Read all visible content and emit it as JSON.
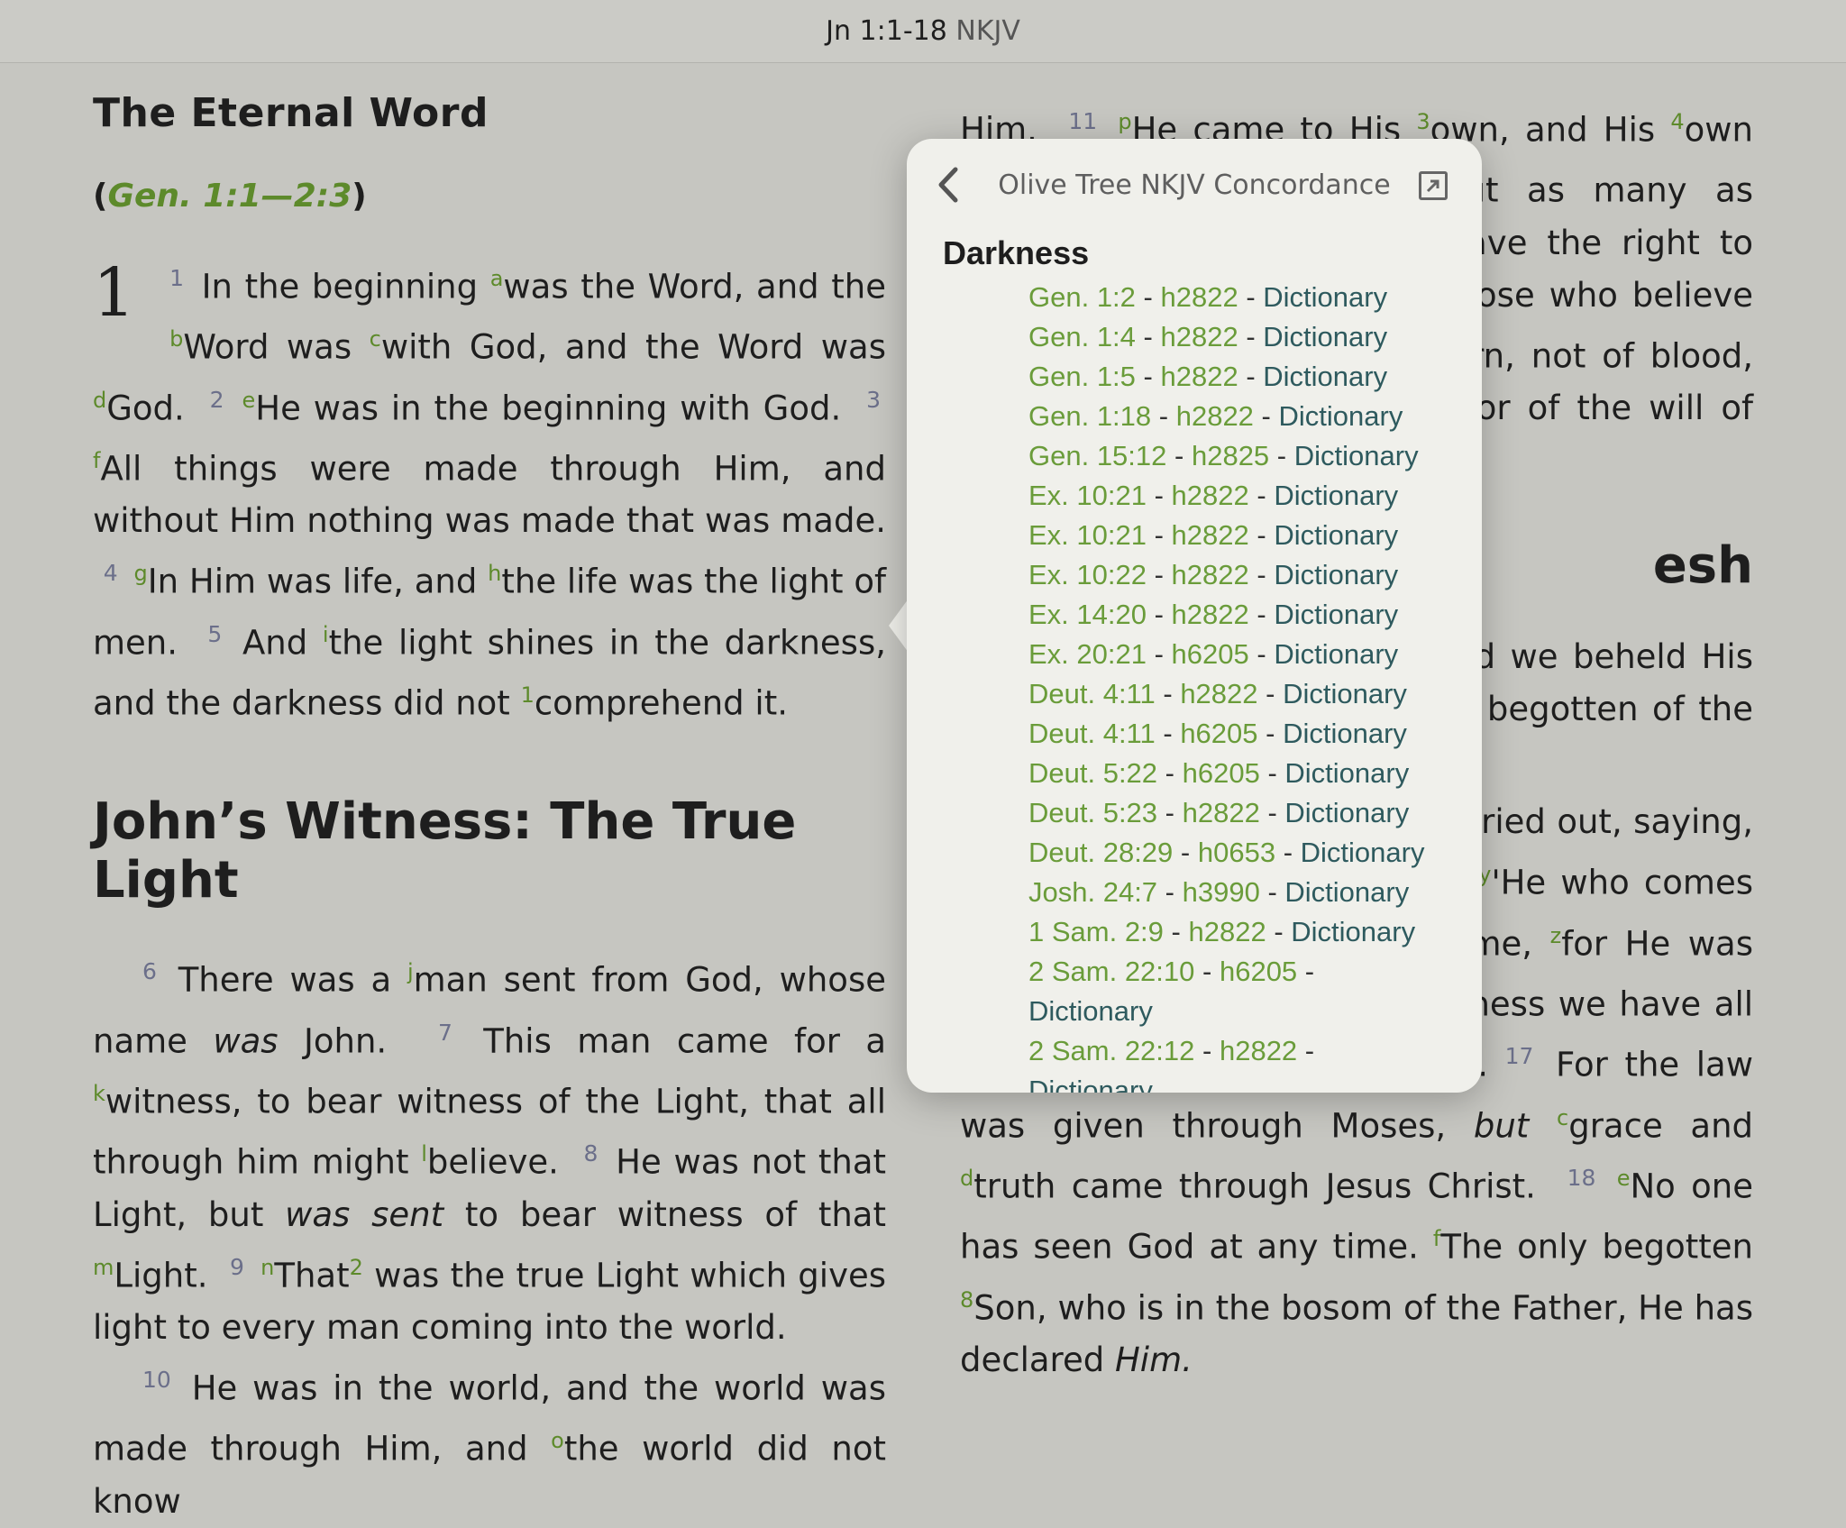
{
  "topbar": {
    "reference": "Jn 1:1-18",
    "version": "NKJV"
  },
  "left": {
    "heading": "The Eternal Word",
    "xref": "Gen. 1:1—2:3",
    "chapter": "1",
    "heading2": "John’s Witness: The True Light"
  },
  "right": {
    "heading_fragment": "esh"
  },
  "popover": {
    "title": "Olive Tree NKJV Concordance",
    "word": "Darkness",
    "entries": [
      {
        "ref": "Gen. 1:2",
        "code": "h2822",
        "dict": "Dictionary"
      },
      {
        "ref": "Gen. 1:4",
        "code": "h2822",
        "dict": "Dictionary"
      },
      {
        "ref": "Gen. 1:5",
        "code": "h2822",
        "dict": "Dictionary"
      },
      {
        "ref": "Gen. 1:18",
        "code": "h2822",
        "dict": "Dictionary"
      },
      {
        "ref": "Gen. 15:12",
        "code": "h2825",
        "dict": "Dictionary"
      },
      {
        "ref": "Ex. 10:21",
        "code": "h2822",
        "dict": "Dictionary"
      },
      {
        "ref": "Ex. 10:21",
        "code": "h2822",
        "dict": "Dictionary"
      },
      {
        "ref": "Ex. 10:22",
        "code": "h2822",
        "dict": "Dictionary"
      },
      {
        "ref": "Ex. 14:20",
        "code": "h2822",
        "dict": "Dictionary"
      },
      {
        "ref": "Ex. 20:21",
        "code": "h6205",
        "dict": "Dictionary"
      },
      {
        "ref": "Deut. 4:11",
        "code": "h2822",
        "dict": "Dictionary"
      },
      {
        "ref": "Deut. 4:11",
        "code": "h6205",
        "dict": "Dictionary"
      },
      {
        "ref": "Deut. 5:22",
        "code": "h6205",
        "dict": "Dictionary"
      },
      {
        "ref": "Deut. 5:23",
        "code": "h2822",
        "dict": "Dictionary"
      },
      {
        "ref": "Deut. 28:29",
        "code": "h0653",
        "dict": "Dictionary"
      },
      {
        "ref": "Josh. 24:7",
        "code": "h3990",
        "dict": "Dictionary"
      },
      {
        "ref": "1 Sam. 2:9",
        "code": "h2822",
        "dict": "Dictionary"
      },
      {
        "ref": "2 Sam. 22:10",
        "code": "h6205",
        "dict": "Dictionary"
      },
      {
        "ref": "2 Sam. 22:12",
        "code": "h2822",
        "dict": "Dictionary"
      }
    ]
  },
  "colors": {
    "green": "#5d8a2b",
    "verse_number": "#6b6f8a",
    "dict": "#2e5a5e"
  },
  "icons": {
    "back": "chevron-left-icon",
    "expand": "expand-icon"
  }
}
